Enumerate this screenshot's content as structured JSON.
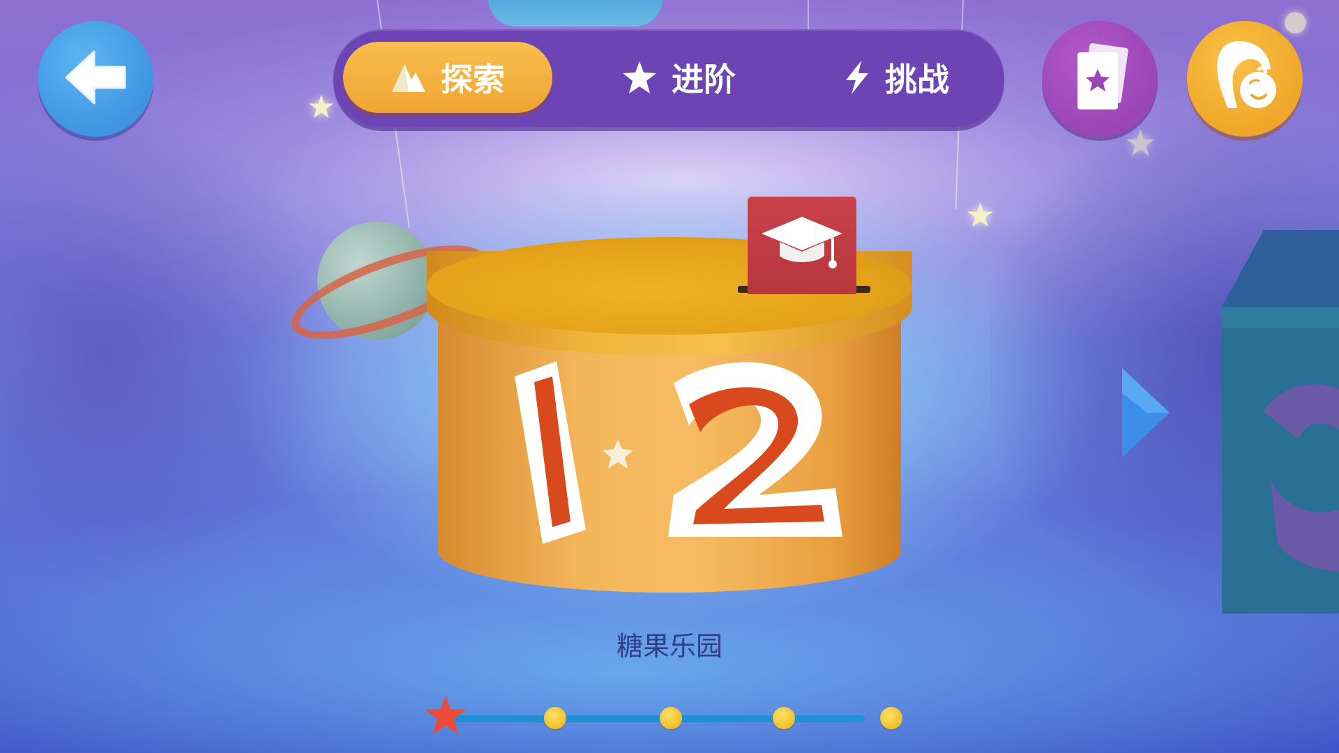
{
  "tabs": [
    {
      "label": "探索",
      "icon": "mountain-icon",
      "active": true
    },
    {
      "label": "进阶",
      "icon": "star-icon",
      "active": false
    },
    {
      "label": "挑战",
      "icon": "lightning-icon",
      "active": false
    }
  ],
  "header": {
    "back_icon": "back-arrow-icon",
    "cards_icon": "star-card-icon",
    "profile_icon": "mother-child-icon"
  },
  "level": {
    "title": "糖果乐园",
    "badge_icon": "graduation-cap-icon",
    "number_left": "1",
    "number_right": "2",
    "next_level_partial_number": "3"
  },
  "progress": {
    "total_stages": 5,
    "current_stage": 1
  },
  "colors": {
    "tab_bar": "#6c44b4",
    "tab_active": "#f6b443",
    "back_button": "#4aa3ea",
    "cards_button": "#a64fbe",
    "profile_button": "#f4b237",
    "number_red": "#d84a1e",
    "track": "#1f8fd8"
  }
}
